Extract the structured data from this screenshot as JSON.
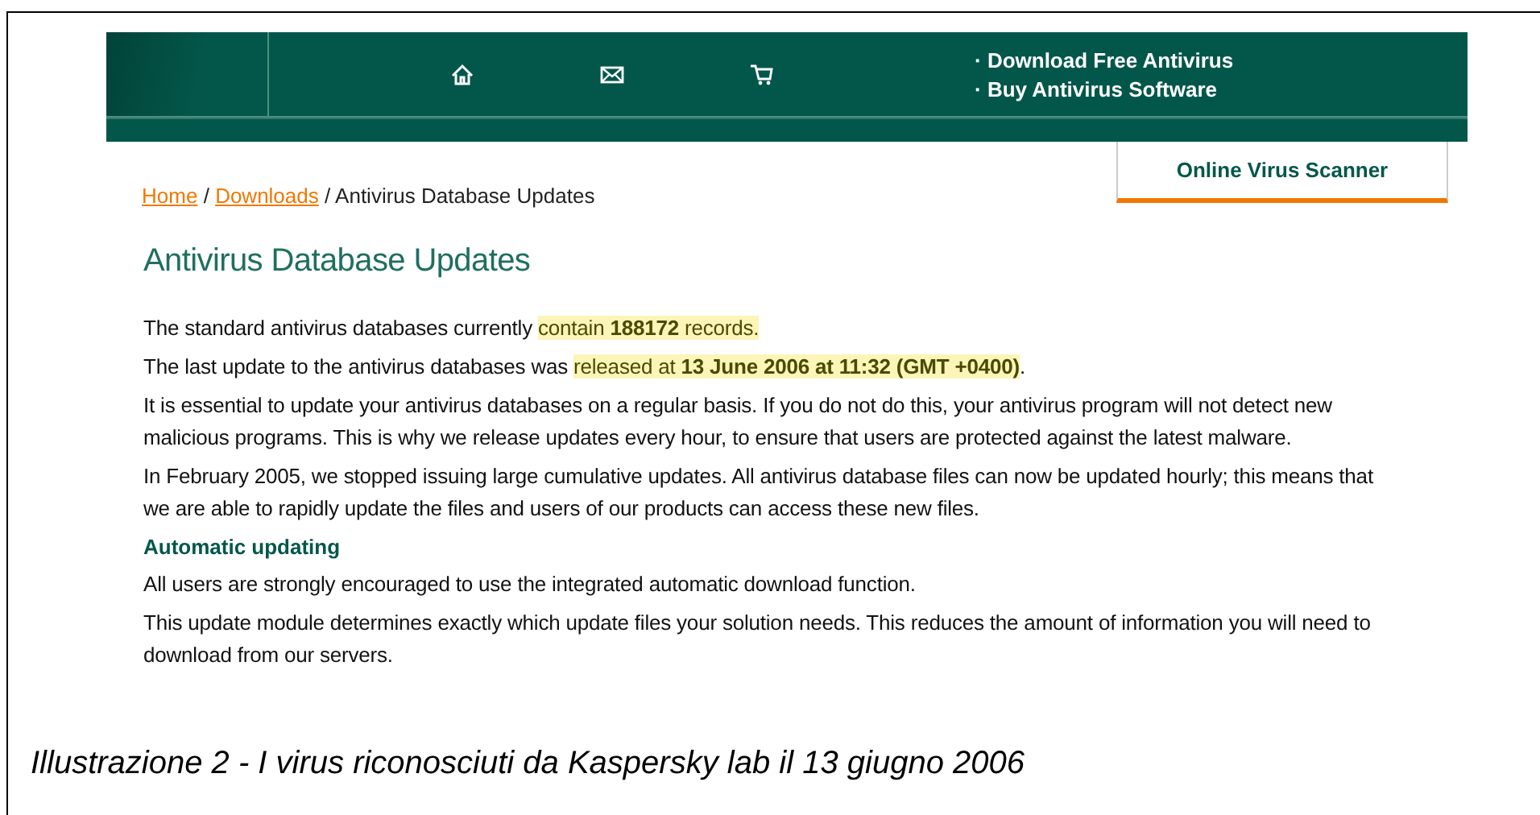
{
  "header": {
    "nav_icons": [
      {
        "kind": "home"
      },
      {
        "kind": "mail"
      },
      {
        "kind": "cart"
      }
    ],
    "links": [
      "· Download Free Antivirus",
      "· Buy Antivirus Software"
    ]
  },
  "scanner_tab": {
    "label": "Online Virus Scanner"
  },
  "breadcrumb": {
    "links": [
      "Home",
      "Downloads"
    ],
    "current": "Antivirus Database Updates",
    "separator": "/"
  },
  "title": "Antivirus Database Updates",
  "paragraphs": [
    {
      "kind": "text",
      "segments": [
        {
          "text": "The standard antivirus databases currently ",
          "highlighted": false
        },
        {
          "text": "contain **188172** records.",
          "highlighted": true
        }
      ]
    },
    {
      "kind": "text",
      "segments": [
        {
          "text": "The last update to the antivirus databases was ",
          "highlighted": false
        },
        {
          "text": "released at **13 June 2006 at 11:32 (GMT +0400)**",
          "highlighted": true
        },
        {
          "text": ".",
          "highlighted": false
        }
      ]
    },
    {
      "kind": "text",
      "segments": [
        {
          "text": "It is essential to update your antivirus databases on a regular basis. If you do not do this, your antivirus program will not detect new malicious programs. This is why we release updates every hour, to ensure that users are protected against the latest malware.",
          "highlighted": false
        }
      ]
    },
    {
      "kind": "text",
      "segments": [
        {
          "text": "In February 2005, we stopped issuing large cumulative updates. All antivirus database files can now be updated hourly; this means that we are able to rapidly update the files and users of our products can access these new files.",
          "highlighted": false
        }
      ]
    },
    {
      "kind": "heading",
      "segments": [
        {
          "text": "Automatic updating",
          "highlighted": false
        }
      ]
    },
    {
      "kind": "text",
      "segments": [
        {
          "text": "All users are strongly encouraged to use the integrated automatic download function.",
          "highlighted": false
        }
      ]
    },
    {
      "kind": "text",
      "segments": [
        {
          "text": "This update module determines exactly which update files your solution needs. This reduces the amount of information you will need to download from our servers.",
          "highlighted": false
        }
      ]
    }
  ],
  "caption": "Illustrazione 2 - I virus riconosciuti da Kaspersky lab il 13 giugno 2006"
}
